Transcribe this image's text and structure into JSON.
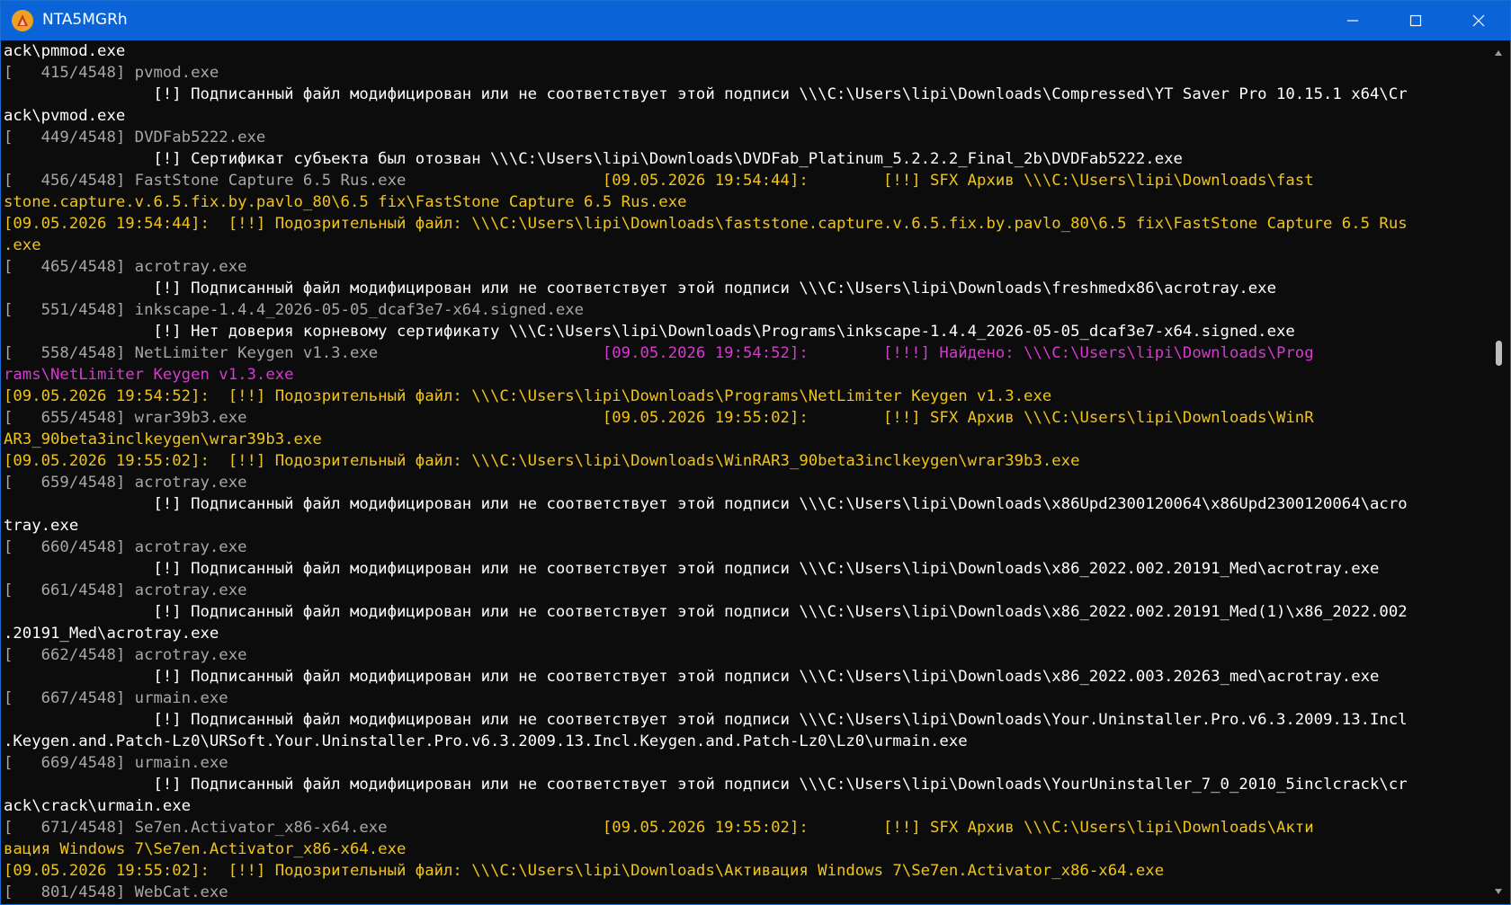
{
  "window": {
    "title": "NTA5MGRh"
  },
  "lines": [
    [
      {
        "c": "w",
        "t": "ack\\pmmod.exe"
      }
    ],
    [
      {
        "c": "g",
        "t": "[   415/4548] pvmod.exe"
      }
    ],
    [
      {
        "c": "w",
        "t": "                [!] Подписанный файл модифицирован или не соответствует этой подписи \\\\\\C:\\Users\\lipi\\Downloads\\Compressed\\YT Saver Pro 10.15.1 x64\\Cr"
      }
    ],
    [
      {
        "c": "w",
        "t": "ack\\pvmod.exe"
      }
    ],
    [
      {
        "c": "g",
        "t": "[   449/4548] DVDFab5222.exe"
      }
    ],
    [
      {
        "c": "w",
        "t": "                [!] Сертификат субъекта был отозван \\\\\\C:\\Users\\lipi\\Downloads\\DVDFab_Platinum_5.2.2.2_Final_2b\\DVDFab5222.exe"
      }
    ],
    [
      {
        "c": "g",
        "t": "[   456/4548] FastStone Capture 6.5 Rus.exe                     "
      },
      {
        "c": "y",
        "t": "[09.05.2026 19:54:44]:        [!!] SFX Архив \\\\\\C:\\Users\\lipi\\Downloads\\fast"
      }
    ],
    [
      {
        "c": "y",
        "t": "stone.capture.v.6.5.fix.by.pavlo_80\\6.5 fix\\FastStone Capture 6.5 Rus.exe"
      }
    ],
    [
      {
        "c": "y",
        "t": "[09.05.2026 19:54:44]:  [!!] Подозрительный файл: \\\\\\C:\\Users\\lipi\\Downloads\\faststone.capture.v.6.5.fix.by.pavlo_80\\6.5 fix\\FastStone Capture 6.5 Rus"
      }
    ],
    [
      {
        "c": "y",
        "t": ".exe"
      }
    ],
    [
      {
        "c": "g",
        "t": "[   465/4548] acrotray.exe"
      }
    ],
    [
      {
        "c": "w",
        "t": "                [!] Подписанный файл модифицирован или не соответствует этой подписи \\\\\\C:\\Users\\lipi\\Downloads\\freshmedx86\\acrotray.exe"
      }
    ],
    [
      {
        "c": "g",
        "t": "[   551/4548] inkscape-1.4.4_2026-05-05_dcaf3e7-x64.signed.exe"
      }
    ],
    [
      {
        "c": "w",
        "t": "                [!] Нет доверия корневому сертификату \\\\\\C:\\Users\\lipi\\Downloads\\Programs\\inkscape-1.4.4_2026-05-05_dcaf3e7-x64.signed.exe"
      }
    ],
    [
      {
        "c": "g",
        "t": "[   558/4548] NetLimiter Keygen v1.3.exe                        "
      },
      {
        "c": "m",
        "t": "[09.05.2026 19:54:52]:        [!!!] Найдено: \\\\\\C:\\Users\\lipi\\Downloads\\Prog"
      }
    ],
    [
      {
        "c": "m",
        "t": "rams\\NetLimiter Keygen v1.3.exe"
      }
    ],
    [
      {
        "c": "y",
        "t": "[09.05.2026 19:54:52]:  [!!] Подозрительный файл: \\\\\\C:\\Users\\lipi\\Downloads\\Programs\\NetLimiter Keygen v1.3.exe"
      }
    ],
    [
      {
        "c": "g",
        "t": "[   655/4548] wrar39b3.exe                                      "
      },
      {
        "c": "y",
        "t": "[09.05.2026 19:55:02]:        [!!] SFX Архив \\\\\\C:\\Users\\lipi\\Downloads\\WinR"
      }
    ],
    [
      {
        "c": "y",
        "t": "AR3_90beta3inclkeygen\\wrar39b3.exe"
      }
    ],
    [
      {
        "c": "y",
        "t": "[09.05.2026 19:55:02]:  [!!] Подозрительный файл: \\\\\\C:\\Users\\lipi\\Downloads\\WinRAR3_90beta3inclkeygen\\wrar39b3.exe"
      }
    ],
    [
      {
        "c": "g",
        "t": "[   659/4548] acrotray.exe"
      }
    ],
    [
      {
        "c": "w",
        "t": "                [!] Подписанный файл модифицирован или не соответствует этой подписи \\\\\\C:\\Users\\lipi\\Downloads\\x86Upd2300120064\\x86Upd2300120064\\acro"
      }
    ],
    [
      {
        "c": "w",
        "t": "tray.exe"
      }
    ],
    [
      {
        "c": "g",
        "t": "[   660/4548] acrotray.exe"
      }
    ],
    [
      {
        "c": "w",
        "t": "                [!] Подписанный файл модифицирован или не соответствует этой подписи \\\\\\C:\\Users\\lipi\\Downloads\\x86_2022.002.20191_Med\\acrotray.exe"
      }
    ],
    [
      {
        "c": "g",
        "t": "[   661/4548] acrotray.exe"
      }
    ],
    [
      {
        "c": "w",
        "t": "                [!] Подписанный файл модифицирован или не соответствует этой подписи \\\\\\C:\\Users\\lipi\\Downloads\\x86_2022.002.20191_Med(1)\\x86_2022.002"
      }
    ],
    [
      {
        "c": "w",
        "t": ".20191_Med\\acrotray.exe"
      }
    ],
    [
      {
        "c": "g",
        "t": "[   662/4548] acrotray.exe"
      }
    ],
    [
      {
        "c": "w",
        "t": "                [!] Подписанный файл модифицирован или не соответствует этой подписи \\\\\\C:\\Users\\lipi\\Downloads\\x86_2022.003.20263_med\\acrotray.exe"
      }
    ],
    [
      {
        "c": "g",
        "t": "[   667/4548] urmain.exe"
      }
    ],
    [
      {
        "c": "w",
        "t": "                [!] Подписанный файл модифицирован или не соответствует этой подписи \\\\\\C:\\Users\\lipi\\Downloads\\Your.Uninstaller.Pro.v6.3.2009.13.Incl"
      }
    ],
    [
      {
        "c": "w",
        "t": ".Keygen.and.Patch-Lz0\\URSoft.Your.Uninstaller.Pro.v6.3.2009.13.Incl.Keygen.and.Patch-Lz0\\Lz0\\urmain.exe"
      }
    ],
    [
      {
        "c": "g",
        "t": "[   669/4548] urmain.exe"
      }
    ],
    [
      {
        "c": "w",
        "t": "                [!] Подписанный файл модифицирован или не соответствует этой подписи \\\\\\C:\\Users\\lipi\\Downloads\\YourUninstaller_7_0_2010_5inclcrack\\cr"
      }
    ],
    [
      {
        "c": "w",
        "t": "ack\\crack\\urmain.exe"
      }
    ],
    [
      {
        "c": "g",
        "t": "[   671/4548] Se7en.Activator_x86-x64.exe                       "
      },
      {
        "c": "y",
        "t": "[09.05.2026 19:55:02]:        [!!] SFX Архив \\\\\\C:\\Users\\lipi\\Downloads\\Акти"
      }
    ],
    [
      {
        "c": "y",
        "t": "вация Windows 7\\Se7en.Activator_x86-x64.exe"
      }
    ],
    [
      {
        "c": "y",
        "t": "[09.05.2026 19:55:02]:  [!!] Подозрительный файл: \\\\\\C:\\Users\\lipi\\Downloads\\Активация Windows 7\\Se7en.Activator_x86-x64.exe"
      }
    ],
    [
      {
        "c": "g",
        "t": "[   801/4548] WebCat.exe"
      }
    ]
  ]
}
